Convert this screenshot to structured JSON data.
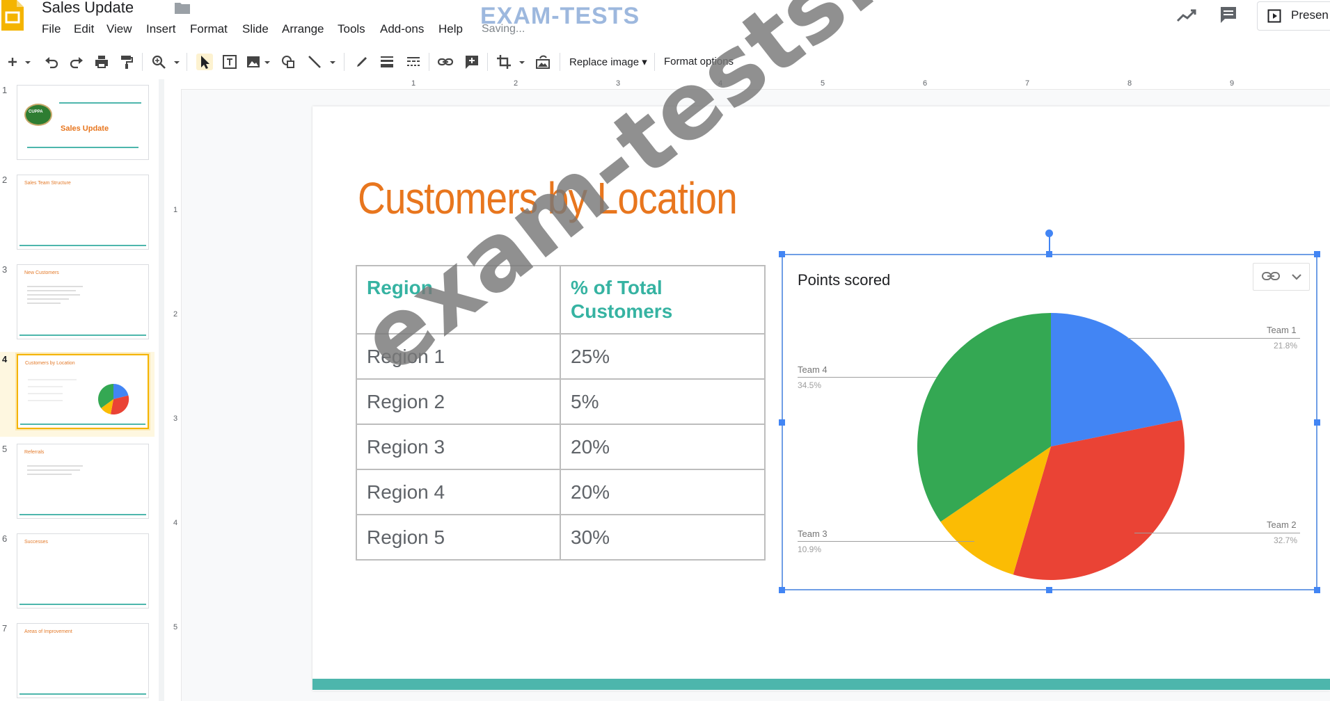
{
  "window": {
    "doc_title": "Sales Update",
    "saving_status": "Saving...",
    "watermark_top": "EXAM-TESTS",
    "present_label": "Presen"
  },
  "menu": [
    "File",
    "Edit",
    "View",
    "Insert",
    "Format",
    "Slide",
    "Arrange",
    "Tools",
    "Add-ons",
    "Help"
  ],
  "toolbar": {
    "icons": [
      "add-icon",
      "undo-icon",
      "redo-icon",
      "print-icon",
      "paint-format-icon",
      "zoom-icon",
      "select-icon",
      "text-box-icon",
      "image-icon",
      "shape-icon",
      "line-icon",
      "pen-icon",
      "border-weight-icon",
      "border-dash-icon",
      "link-icon",
      "add-comment-icon",
      "crop-icon",
      "reset-image-icon"
    ],
    "replace_image": "Replace image ▾",
    "format_options": "Format options"
  },
  "filmstrip": {
    "slides": [
      {
        "num": "1",
        "title": "Sales Update",
        "badge": "CUPPA"
      },
      {
        "num": "2",
        "title": "Sales Team Structure"
      },
      {
        "num": "3",
        "title": "New Customers"
      },
      {
        "num": "4",
        "title": "Customers by Location",
        "active": true
      },
      {
        "num": "5",
        "title": "Referrals"
      },
      {
        "num": "6",
        "title": "Successes"
      },
      {
        "num": "7",
        "title": "Areas of Improvement"
      }
    ]
  },
  "rulers": {
    "top": [
      "1",
      "2",
      "3",
      "4",
      "5",
      "6",
      "7",
      "8",
      "9"
    ],
    "left": [
      "1",
      "2",
      "3",
      "4",
      "5"
    ]
  },
  "slide": {
    "title": "Customers by Location",
    "table": {
      "headers": [
        "Region",
        "% of Total Customers"
      ],
      "rows": [
        [
          "Region 1",
          "25%"
        ],
        [
          "Region 2",
          "5%"
        ],
        [
          "Region 3",
          "20%"
        ],
        [
          "Region 4",
          "20%"
        ],
        [
          "Region 5",
          "30%"
        ]
      ]
    }
  },
  "chart_data": {
    "type": "pie",
    "title": "Points scored",
    "categories": [
      "Team 1",
      "Team 2",
      "Team 3",
      "Team 4"
    ],
    "values": [
      21.8,
      32.7,
      10.9,
      34.5
    ],
    "value_labels": [
      "21.8%",
      "32.7%",
      "10.9%",
      "34.5%"
    ],
    "colors": [
      "#4285f4",
      "#ea4335",
      "#fbbc04",
      "#34a853"
    ],
    "legend": "labeled"
  },
  "watermark": "exam-tests.com"
}
